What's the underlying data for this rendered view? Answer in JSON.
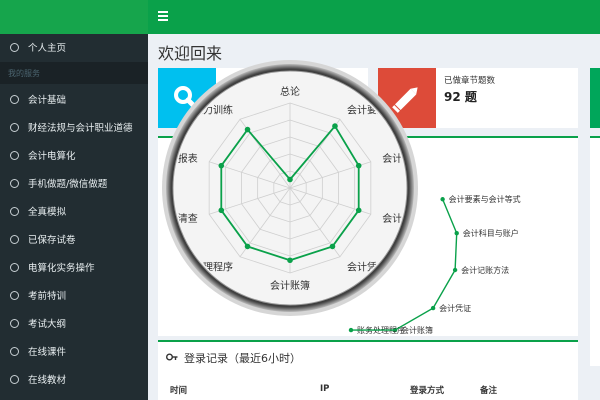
{
  "topbar": {
    "menu_icon": "hamburger-icon"
  },
  "sidebar": {
    "section_header": "我的服务",
    "items": [
      {
        "label": "个人主页"
      },
      {
        "label": "会计基础"
      },
      {
        "label": "财经法规与会计职业道德"
      },
      {
        "label": "会计电算化"
      },
      {
        "label": "手机做题/微信做题"
      },
      {
        "label": "全真模拟"
      },
      {
        "label": "已保存试卷"
      },
      {
        "label": "电算化实务操作"
      },
      {
        "label": "考前特训"
      },
      {
        "label": "考试大纲"
      },
      {
        "label": "在线课件"
      },
      {
        "label": "在线教材"
      }
    ]
  },
  "main": {
    "title": "欢迎回来",
    "tiles": [
      {
        "icon": "search-icon",
        "color": "#00c0ef"
      },
      {
        "icon": "pencil-icon",
        "color": "#dd4b39",
        "label": "已做章节题数",
        "value": "92 题"
      }
    ],
    "login": {
      "title": "登录记录（最近6小时）",
      "columns": [
        "时间",
        "IP",
        "登录方式",
        "备注"
      ]
    }
  },
  "chart_data": {
    "type": "radar",
    "magnified": {
      "axes": [
        "总论",
        "会计要素",
        "会计科",
        "会计记",
        "会计凭",
        "会计账簿",
        "账务处理程序",
        "财产清查",
        "财务报表",
        "计能力训练"
      ],
      "values": [
        0.1,
        0.9,
        0.85,
        0.85,
        0.85,
        0.85,
        0.85,
        0.85,
        0.85,
        0.85
      ],
      "range": [
        0,
        1
      ]
    },
    "background": {
      "axes": [
        "会计要素与会计等式",
        "会计科目与账户",
        "会计记账方法",
        "会计凭证",
        "会计账簿",
        "账务处理程序"
      ]
    },
    "line_color": "#0aa14a"
  }
}
